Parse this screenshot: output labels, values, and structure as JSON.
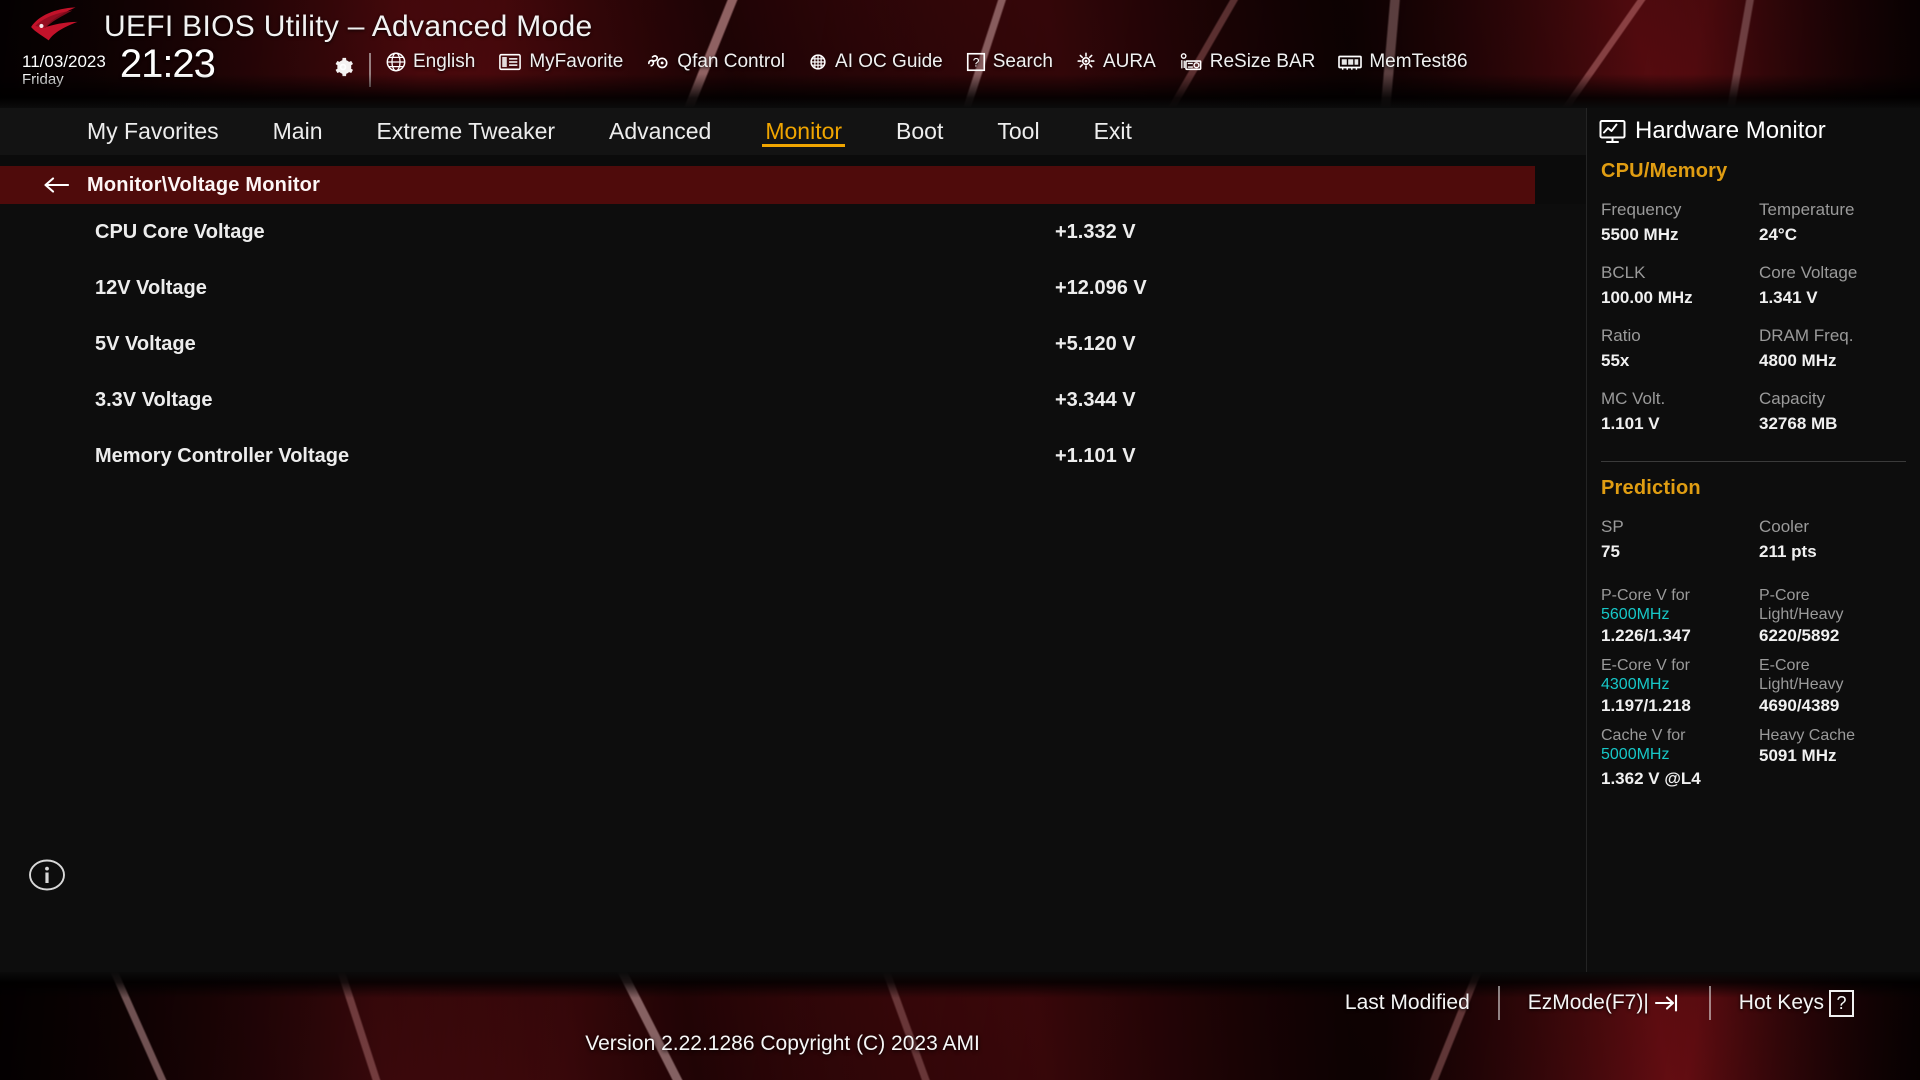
{
  "banner": {
    "app_title": "UEFI BIOS Utility – Advanced Mode",
    "date": "11/03/2023",
    "day": "Friday",
    "time": "21:23",
    "gear_icon": "gear-icon",
    "rog_logo": "rog-logo",
    "toolbar": [
      {
        "label": "English",
        "icon": "globe-icon"
      },
      {
        "label": "MyFavorite",
        "icon": "favorites-list-icon"
      },
      {
        "label": "Qfan Control",
        "icon": "fan-icon"
      },
      {
        "label": "AI OC Guide",
        "icon": "ai-chip-icon"
      },
      {
        "label": "Search",
        "icon": "question-box-icon"
      },
      {
        "label": "AURA",
        "icon": "aura-light-icon"
      },
      {
        "label": "ReSize BAR",
        "icon": "gpu-card-icon"
      },
      {
        "label": "MemTest86",
        "icon": "memory-module-icon"
      }
    ]
  },
  "nav": {
    "tabs": [
      {
        "label": "My Favorites",
        "active": false
      },
      {
        "label": "Main",
        "active": false
      },
      {
        "label": "Extreme Tweaker",
        "active": false
      },
      {
        "label": "Advanced",
        "active": false
      },
      {
        "label": "Monitor",
        "active": true
      },
      {
        "label": "Boot",
        "active": false
      },
      {
        "label": "Tool",
        "active": false
      },
      {
        "label": "Exit",
        "active": false
      }
    ],
    "active_color": "#f0a500"
  },
  "breadcrumb": {
    "back_icon": "back-arrow-icon",
    "path": "Monitor\\Voltage Monitor",
    "background_color": "#4f0b0b"
  },
  "main": {
    "rows": [
      {
        "label": "CPU Core Voltage",
        "value": "+1.332 V"
      },
      {
        "label": "12V Voltage",
        "value": "+12.096 V"
      },
      {
        "label": "5V Voltage",
        "value": "+5.120 V"
      },
      {
        "label": "3.3V Voltage",
        "value": "+3.344 V"
      },
      {
        "label": "Memory Controller Voltage",
        "value": "+1.101 V"
      }
    ],
    "info_icon": "info-icon"
  },
  "hardware_monitor": {
    "title": "Hardware Monitor",
    "title_icon": "monitor-chart-icon",
    "section_color": "#e09d12",
    "cpu_memory": {
      "title": "CPU/Memory",
      "pairs": [
        {
          "k1": "Frequency",
          "v1": "5500 MHz",
          "k2": "Temperature",
          "v2": "24°C"
        },
        {
          "k1": "BCLK",
          "v1": "100.00 MHz",
          "k2": "Core Voltage",
          "v2": "1.341 V"
        },
        {
          "k1": "Ratio",
          "v1": "55x",
          "k2": "DRAM Freq.",
          "v2": "4800 MHz"
        },
        {
          "k1": "MC Volt.",
          "v1": "1.101 V",
          "k2": "Capacity",
          "v2": "32768 MB"
        }
      ]
    },
    "prediction": {
      "title": "Prediction",
      "pairs": [
        {
          "k1": "SP",
          "v1": "75",
          "k2": "Cooler",
          "v2": "211 pts"
        }
      ],
      "details": [
        {
          "k1_line1": "P-Core V for",
          "k1_freq": "5600MHz",
          "v1": "1.226/1.347",
          "k2_line1": "P-Core",
          "k2_line2": "Light/Heavy",
          "v2": "6220/5892"
        },
        {
          "k1_line1": "E-Core V for",
          "k1_freq": "4300MHz",
          "v1": "1.197/1.218",
          "k2_line1": "E-Core",
          "k2_line2": "Light/Heavy",
          "v2": "4690/4389"
        },
        {
          "k1_line1": "Cache V for",
          "k1_freq": "5000MHz",
          "v1": "1.362 V @L4",
          "k2_line1": "Heavy Cache",
          "k2_line2": "",
          "v2": "5091 MHz"
        }
      ],
      "freq_color": "#17c8c8"
    }
  },
  "bottom": {
    "last_modified": "Last Modified",
    "ezmode": "EzMode(F7)|",
    "ezmode_icon": "arrow-into-bracket-icon",
    "hot_keys": "Hot Keys",
    "hot_keys_key": "?",
    "version": "Version 2.22.1286 Copyright (C) 2023 AMI"
  }
}
